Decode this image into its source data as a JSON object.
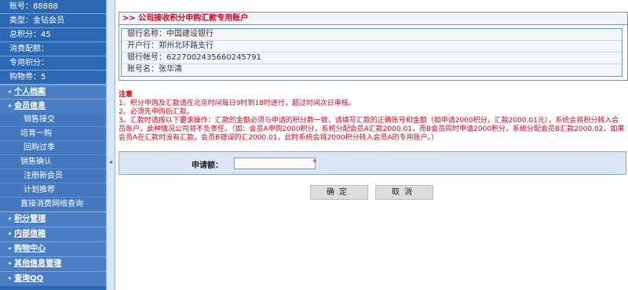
{
  "sidebar": {
    "info": [
      "账号：88888",
      "类型：金钻会员",
      "总积分：45",
      "消费配额：",
      "专用积分：",
      "购物劵：5"
    ],
    "nav": [
      {
        "label": "个人档案"
      },
      {
        "label": "会员信息"
      }
    ],
    "sub_items": [
      "销售接交",
      "培育一购",
      "回购过季",
      "销售确认",
      "注册新会员",
      "计划推荐",
      "直接消费网络查询"
    ],
    "sections": [
      {
        "label": "积分管理"
      },
      {
        "label": "内部信箱"
      },
      {
        "label": "购物中心"
      },
      {
        "label": "其他信息管理"
      },
      {
        "label": "查询QQ"
      }
    ],
    "collapse_glyph": "◂"
  },
  "bank": {
    "title": ">>  公司接收积分申购汇款专用账户",
    "rows": [
      "银行名称：中国建设银行",
      "开户行：郑州北环路支行",
      "银行帐号：6227002435660245791",
      "账号名：张华清"
    ]
  },
  "notes": {
    "heading": "注意",
    "lines": [
      "1、积分申购及汇款请在北京时间每日9时到18时进行，超过时间次日审核。",
      "2、必须先申购后汇款。",
      "3、汇款时请按以下要求操作：汇款的金额必须与申请的积分数一致，请填写汇款的正确账号和金额（如申请2000积分，汇款2000.01元），系统会将积分转入会员账户，此种情况公司将不负责任。（如：会员A申购2000积分，系统分配会员A汇款2000.01，而B会员同时申请2000积分，系统分配会员B汇款2000.02，如果会员A在汇款时没有汇款，会员B错误的汇2000.01，此时系统会将2000积分转入会员A的专用账户。）"
    ]
  },
  "apply": {
    "label": "申请额：",
    "value": "",
    "required_mark": "*"
  },
  "buttons": {
    "confirm": "确定",
    "cancel": "取消"
  },
  "colors": {
    "sidebar_bg": "#2c68b4",
    "accent_red": "#d8001a",
    "panel_bg": "#dbe6f4"
  }
}
